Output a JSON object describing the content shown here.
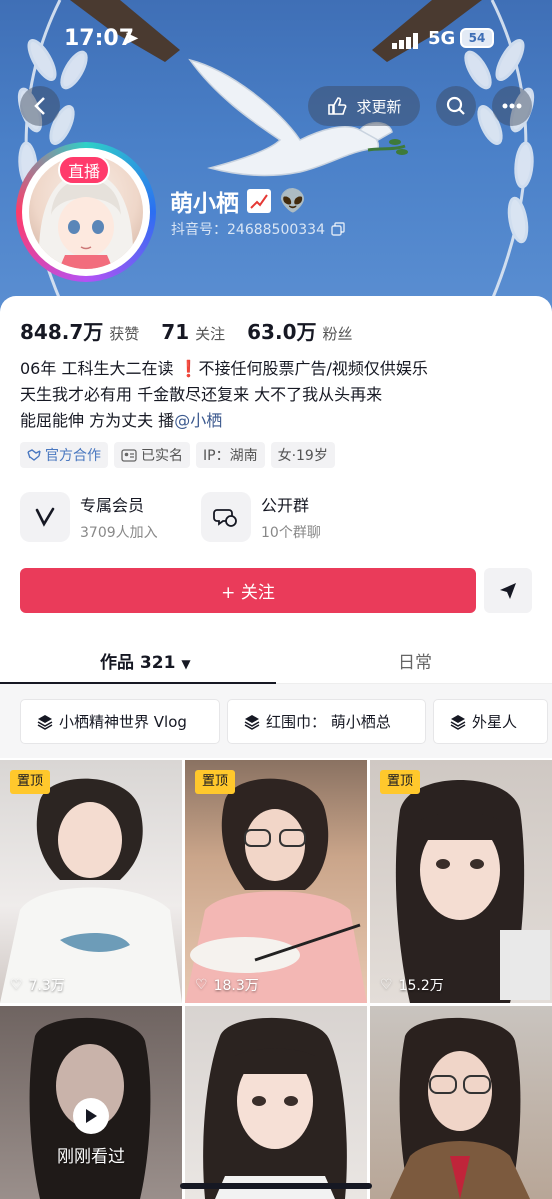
{
  "status_bar": {
    "time": "17:07",
    "network": "5G",
    "battery": "54"
  },
  "header": {
    "update_button_label": "求更新"
  },
  "profile": {
    "live_badge": "直播",
    "nickname": "萌小栖",
    "douyin_id": "抖音号：24688500334"
  },
  "stats": [
    {
      "value": "848.7万",
      "label": "获赞"
    },
    {
      "value": "71",
      "label": "关注"
    },
    {
      "value": "63.0万",
      "label": "粉丝"
    }
  ],
  "bio": {
    "line1_a": "06年  工科生大二在读  ",
    "line1_warn": "❗",
    "line1_b": "不接任何股票广告/视频仅供娱乐",
    "line2": "天生我才必有用 千金散尽还复来 大不了我从头再来",
    "line3_a": "能屈能伸 方为丈夫 播",
    "line3_mention": "@小栖"
  },
  "tags": [
    "官方合作",
    "已实名",
    "IP：湖南",
    "女·19岁"
  ],
  "services": [
    {
      "title": "专属会员",
      "subtitle": "3709人加入"
    },
    {
      "title": "公开群",
      "subtitle": "10个群聊"
    }
  ],
  "follow_button": "+ 关注",
  "tabs": {
    "works": "作品 321",
    "daily": "日常"
  },
  "collections": [
    "小栖精神世界 Vlog",
    "红围巾： 萌小栖总",
    "外星人"
  ],
  "videos": [
    {
      "pinned": "置顶",
      "likes": "7.3万"
    },
    {
      "pinned": "置顶",
      "likes": "18.3万"
    },
    {
      "pinned": "置顶",
      "likes": "15.2万"
    },
    {
      "watched": "刚刚看过"
    },
    {},
    {}
  ],
  "colors": {
    "accent": "#ea3b5a",
    "pinned": "#ffc82c",
    "banner": "#4a80c8",
    "mention": "#3d5a8f"
  }
}
